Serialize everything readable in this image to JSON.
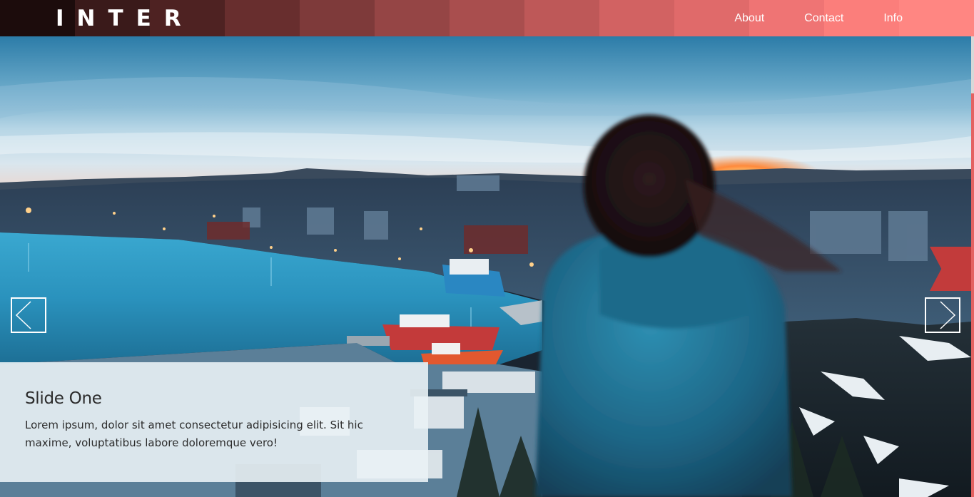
{
  "header": {
    "logo": "INTER",
    "nav": [
      {
        "label": "About"
      },
      {
        "label": "Contact"
      },
      {
        "label": "Info"
      }
    ]
  },
  "slider": {
    "current_slide": {
      "title": "Slide One",
      "text": "Lorem ipsum, dolor sit amet consectetur adipisicing elit. Sit hic maxime, voluptatibus labore doloremque vero!"
    },
    "prev_icon": "chevron-left-icon",
    "next_icon": "chevron-right-icon"
  },
  "colors": {
    "header_dark": "#1c0c0c",
    "header_light": "#ff8682",
    "accent_red": "#c23b3b",
    "caption_bg": "#e9f2f5"
  }
}
